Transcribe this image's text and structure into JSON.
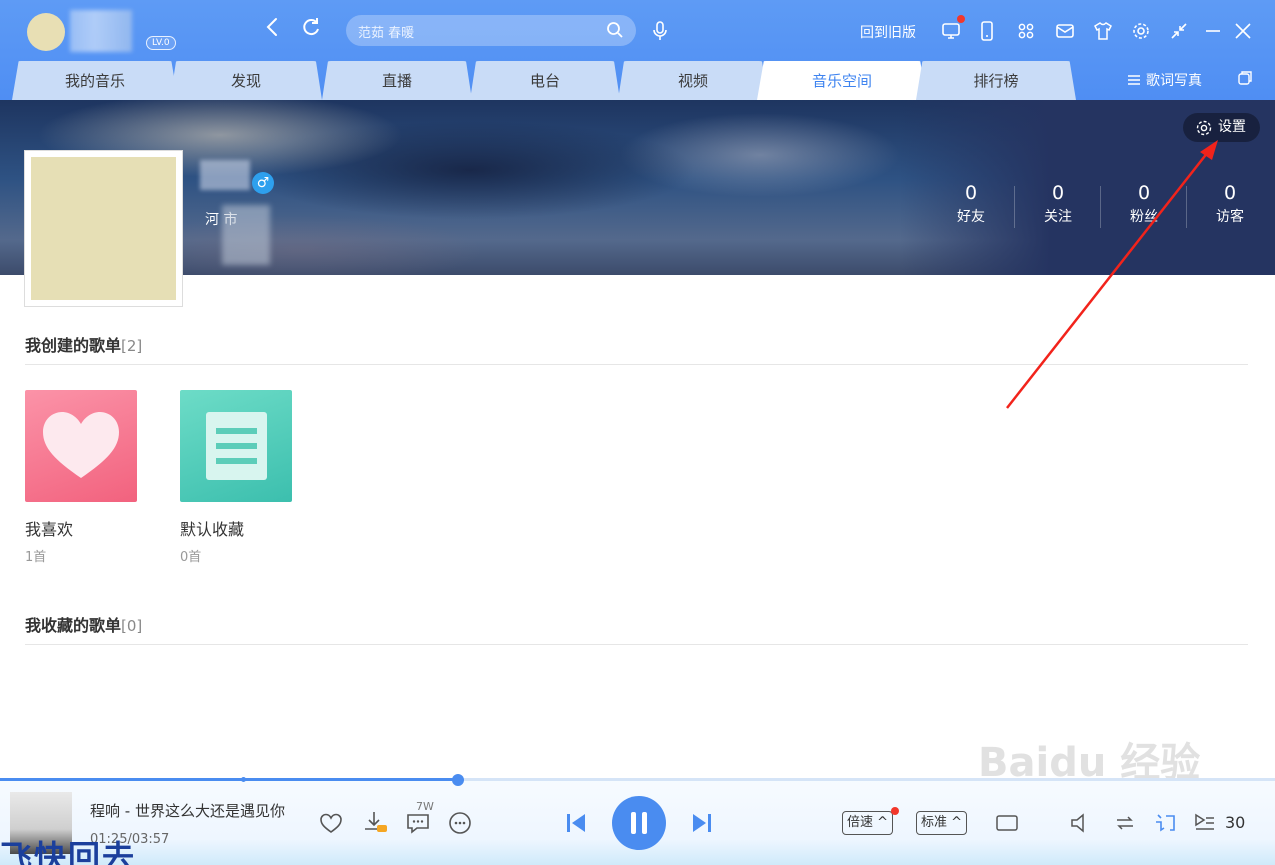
{
  "header": {
    "level_badge": "LV.0",
    "search_placeholder": "范茹 春暖",
    "old_version": "回到旧版"
  },
  "tabs": [
    {
      "label": "我的音乐"
    },
    {
      "label": "发现"
    },
    {
      "label": "直播"
    },
    {
      "label": "电台"
    },
    {
      "label": "视频"
    },
    {
      "label": "音乐空间",
      "active": true
    },
    {
      "label": "排行榜"
    }
  ],
  "lyric_photo": "歌词写真",
  "profile": {
    "settings_label": "设置",
    "gender_symbol": "♂",
    "location": "河              市",
    "stats": [
      {
        "value": "0",
        "label": "好友"
      },
      {
        "value": "0",
        "label": "关注"
      },
      {
        "value": "0",
        "label": "粉丝"
      },
      {
        "value": "0",
        "label": "访客"
      }
    ]
  },
  "created_playlists": {
    "title": "我创建的歌单",
    "count": "[2]",
    "items": [
      {
        "name": "我喜欢",
        "count": "1首",
        "icon": "heart-icon",
        "color": "#f7728c"
      },
      {
        "name": "默认收藏",
        "count": "0首",
        "icon": "document-icon",
        "color": "#52cdb9"
      }
    ]
  },
  "collected_playlists": {
    "title": "我收藏的歌单",
    "count": "[0]"
  },
  "player": {
    "song": "程响 - 世界这么大还是遇见你",
    "time": "01:25/03:57",
    "progress": 0.359,
    "comment_count": "7W",
    "speed_label": "倍速",
    "quality_label": "标准",
    "volume": "30",
    "accent_color": "#4a8cf0"
  },
  "watermark": "Baidu 经验",
  "overlay_text": "飞快回去"
}
